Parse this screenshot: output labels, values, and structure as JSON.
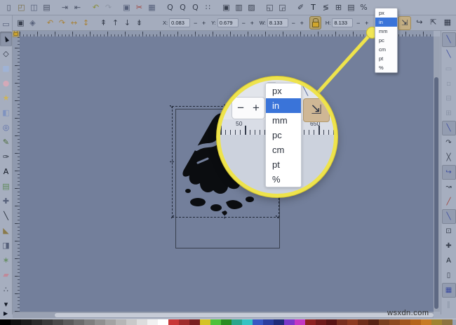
{
  "colors": {
    "accent_blue": "#3a74d9",
    "callout_yellow": "#eee34c",
    "chrome": "#a6aebf",
    "canvas": "#737f9b"
  },
  "commands_bar": {
    "items": [
      {
        "n": "new-document",
        "g": "▯",
        "c": "#4a5266"
      },
      {
        "n": "open-document",
        "g": "◰",
        "c": "#7a6f4a"
      },
      {
        "n": "save-document",
        "g": "◫",
        "c": "#56607a"
      },
      {
        "n": "print-document",
        "g": "▤",
        "c": "#4a5266"
      },
      {
        "n": "import",
        "g": "⇥",
        "c": "#4a5266",
        "gap": true
      },
      {
        "n": "export",
        "g": "⇤",
        "c": "#4a5266"
      },
      {
        "n": "undo",
        "g": "↶",
        "c": "#8a8f3a",
        "gap": true
      },
      {
        "n": "redo",
        "g": "↷",
        "c": "#8e96a6"
      },
      {
        "n": "copy",
        "g": "▣",
        "c": "#56607a",
        "gap": true
      },
      {
        "n": "cut",
        "g": "✂",
        "c": "#a04038"
      },
      {
        "n": "paste",
        "g": "▦",
        "c": "#56607a"
      },
      {
        "n": "zoom-selection",
        "g": "Q",
        "c": "#39404f",
        "gap": true
      },
      {
        "n": "zoom-drawing",
        "g": "Q",
        "c": "#39404f"
      },
      {
        "n": "zoom-page",
        "g": "Q",
        "c": "#39404f"
      },
      {
        "n": "zoom-fit",
        "g": "∷",
        "c": "#39404f"
      },
      {
        "n": "duplicate",
        "g": "▣",
        "c": "#39404f",
        "gap": true
      },
      {
        "n": "clone",
        "g": "▥",
        "c": "#39404f"
      },
      {
        "n": "unlink-clone",
        "g": "▨",
        "c": "#39404f"
      },
      {
        "n": "group",
        "g": "◱",
        "c": "#39404f",
        "gap": true
      },
      {
        "n": "ungroup",
        "g": "◲",
        "c": "#39404f"
      },
      {
        "n": "fill-stroke-dialog",
        "g": "✐",
        "c": "#2e3545",
        "gap": true
      },
      {
        "n": "text-dialog",
        "g": "T",
        "c": "#1c2430"
      },
      {
        "n": "xml-editor",
        "g": "≶",
        "c": "#39404f"
      },
      {
        "n": "align-distribute",
        "g": "⊞",
        "c": "#39404f"
      },
      {
        "n": "document-properties",
        "g": "▤",
        "c": "#39404f"
      },
      {
        "n": "preferences",
        "g": "%",
        "c": "#39404f"
      }
    ]
  },
  "tool_controls": {
    "left_items": [
      {
        "n": "select-all",
        "g": "▣",
        "c": "#39404f"
      },
      {
        "n": "deselect",
        "g": "◈",
        "c": "#56607a"
      },
      {
        "n": "rotate-ccw",
        "g": "↶",
        "c": "#a8833c",
        "gap": true
      },
      {
        "n": "rotate-cw",
        "g": "↷",
        "c": "#a8833c"
      },
      {
        "n": "flip-horizontal",
        "g": "↔",
        "c": "#a8833c"
      },
      {
        "n": "flip-vertical",
        "g": "↕",
        "c": "#a8833c"
      },
      {
        "n": "raise-to-top",
        "g": "⇞",
        "c": "#39404f",
        "gap": true
      },
      {
        "n": "raise",
        "g": "↑",
        "c": "#39404f"
      },
      {
        "n": "lower",
        "g": "↓",
        "c": "#39404f"
      },
      {
        "n": "lower-to-bottom",
        "g": "⇟",
        "c": "#39404f"
      }
    ],
    "fields": {
      "x": {
        "label": "X:",
        "value": "0.083"
      },
      "y": {
        "label": "Y:",
        "value": "0.679"
      },
      "w": {
        "label": "W:",
        "value": "8.133"
      },
      "h": {
        "label": "H:",
        "value": "8.133"
      }
    },
    "minus": "−",
    "plus": "+",
    "affect_items": [
      {
        "n": "scale-stroke-toggle",
        "g": "⇲",
        "c": "#2e3545",
        "on": true
      },
      {
        "n": "scale-corners-toggle",
        "g": "↪",
        "c": "#2e3545"
      },
      {
        "n": "scale-gradient-toggle",
        "g": "⇱",
        "c": "#2e3545"
      },
      {
        "n": "scale-pattern-toggle",
        "g": "▦",
        "c": "#2e3545"
      }
    ]
  },
  "unit_options": [
    {
      "n": "unit-px",
      "label": "px"
    },
    {
      "n": "unit-in",
      "label": "in",
      "sel": true
    },
    {
      "n": "unit-mm",
      "label": "mm"
    },
    {
      "n": "unit-pc",
      "label": "pc"
    },
    {
      "n": "unit-cm",
      "label": "cm"
    },
    {
      "n": "unit-pt",
      "label": "pt"
    },
    {
      "n": "unit-percent",
      "label": "%"
    }
  ],
  "toolbox": {
    "items": [
      {
        "n": "measure-tool",
        "g": "▭",
        "c": "#56607a"
      },
      {
        "n": "selector-tool",
        "g": "►",
        "c": "#111723",
        "sel": true
      },
      {
        "n": "node-tool",
        "g": "◇",
        "c": "#2e3545"
      },
      {
        "n": "rectangle-tool",
        "g": "■",
        "c": "#9fb3d6"
      },
      {
        "n": "ellipse-tool",
        "g": "●",
        "c": "#d4a9b8"
      },
      {
        "n": "star-tool",
        "g": "★",
        "c": "#cdb45a"
      },
      {
        "n": "box3d-tool",
        "g": "◧",
        "c": "#7f93c0"
      },
      {
        "n": "spiral-tool",
        "g": "◎",
        "c": "#5a6da8"
      },
      {
        "n": "pencil-tool",
        "g": "✎",
        "c": "#4a6b3a"
      },
      {
        "n": "calligraphy-tool",
        "g": "✑",
        "c": "#1c2430"
      },
      {
        "n": "text-tool",
        "g": "A",
        "c": "#111723"
      },
      {
        "n": "image-tool",
        "g": "▤",
        "c": "#5f8a5a"
      },
      {
        "n": "tweak-tool",
        "g": "✚",
        "c": "#56607a"
      },
      {
        "n": "dropper-tool",
        "g": "╲",
        "c": "#1c2430"
      },
      {
        "n": "bucket-tool",
        "g": "◣",
        "c": "#8a7a4a"
      },
      {
        "n": "gradient-tool",
        "g": "◨",
        "c": "#56607a"
      },
      {
        "n": "spray-tool",
        "g": "∗",
        "c": "#5f8a5a"
      },
      {
        "n": "eraser-tool",
        "g": "▰",
        "c": "#c08a9a"
      },
      {
        "n": "connector-tool",
        "g": "∴",
        "c": "#39404f"
      },
      {
        "n": "more-tools",
        "g": "▾",
        "c": "#111723"
      }
    ]
  },
  "snap_bar": {
    "items": [
      {
        "n": "snap-enable",
        "g": "╲",
        "c": "#3a4aa0",
        "on": true
      },
      {
        "n": "snap-bbox",
        "g": "╲",
        "c": "#3a4aa0"
      },
      {
        "n": "snap-bbox-edges",
        "g": "▭",
        "c": "#8a93a6"
      },
      {
        "n": "snap-bbox-corners",
        "g": "▫",
        "c": "#8a93a6"
      },
      {
        "n": "snap-bbox-midpoints",
        "g": "⊟",
        "c": "#8a93a6"
      },
      {
        "n": "snap-bbox-centers",
        "g": "⊞",
        "c": "#8a93a6"
      },
      {
        "n": "snap-nodes",
        "g": "╲",
        "c": "#3a4aa0",
        "on": true
      },
      {
        "n": "snap-paths",
        "g": "↷",
        "c": "#39404f"
      },
      {
        "n": "snap-path-intersections",
        "g": "╳",
        "c": "#39404f"
      },
      {
        "n": "snap-cusp-nodes",
        "g": "↪",
        "c": "#3a4aa0",
        "on": true
      },
      {
        "n": "snap-smooth-nodes",
        "g": "↝",
        "c": "#39404f"
      },
      {
        "n": "snap-midpoints",
        "g": "╱",
        "c": "#a04038"
      },
      {
        "n": "snap-others",
        "g": "╲",
        "c": "#3a4aa0",
        "on": true
      },
      {
        "n": "snap-object-centers",
        "g": "⊡",
        "c": "#39404f"
      },
      {
        "n": "snap-rotation-centers",
        "g": "✚",
        "c": "#39404f"
      },
      {
        "n": "snap-text-baseline",
        "g": "A",
        "c": "#1c2430"
      },
      {
        "n": "snap-page-border",
        "g": "▯",
        "c": "#39404f"
      },
      {
        "n": "snap-grids",
        "g": "▦",
        "c": "#3a4aa0",
        "on": true
      },
      {
        "n": "snap-guides",
        "g": "∥",
        "c": "#8a93a6"
      }
    ]
  },
  "canvas": {
    "selection": {
      "corner_glyph": "↔",
      "edge_h": "↔",
      "edge_v": "↕"
    }
  },
  "magnifier": {
    "minus": "−",
    "plus": "+",
    "affect_glyph": "⇲",
    "ruler_left": "50",
    "ruler_right": "650",
    "ghost_icons": [
      {
        "n": "ghost-pen",
        "g": "✐"
      },
      {
        "n": "ghost-doc",
        "g": "▣"
      },
      {
        "n": "ghost-snap",
        "g": "╲"
      }
    ]
  },
  "palette": {
    "colors": [
      "#000000",
      "#111111",
      "#1c1c1c",
      "#2b2b2b",
      "#3a3a3a",
      "#4a4a4a",
      "#5b5b5b",
      "#6c6c6c",
      "#7e7e7e",
      "#909090",
      "#a3a3a3",
      "#b6b6b6",
      "#c9c9c9",
      "#dddddd",
      "#f1f1f1",
      "#ffffff",
      "#c83737",
      "#a02c2c",
      "#781f1f",
      "#d4c326",
      "#4fc139",
      "#2a8c21",
      "#2ba58c",
      "#35c3c3",
      "#3857c3",
      "#2b3d9e",
      "#1f2b78",
      "#7a37c8",
      "#c337c3",
      "#8c2121",
      "#6e1a1a",
      "#571414",
      "#782f1f",
      "#8c3a21",
      "#6e2d1a",
      "#572314",
      "#783f1f",
      "#8c4a21",
      "#a0561f",
      "#b4641c",
      "#c87a24",
      "#a08431",
      "#8c7340"
    ]
  },
  "watermark": "wsxdn.com"
}
